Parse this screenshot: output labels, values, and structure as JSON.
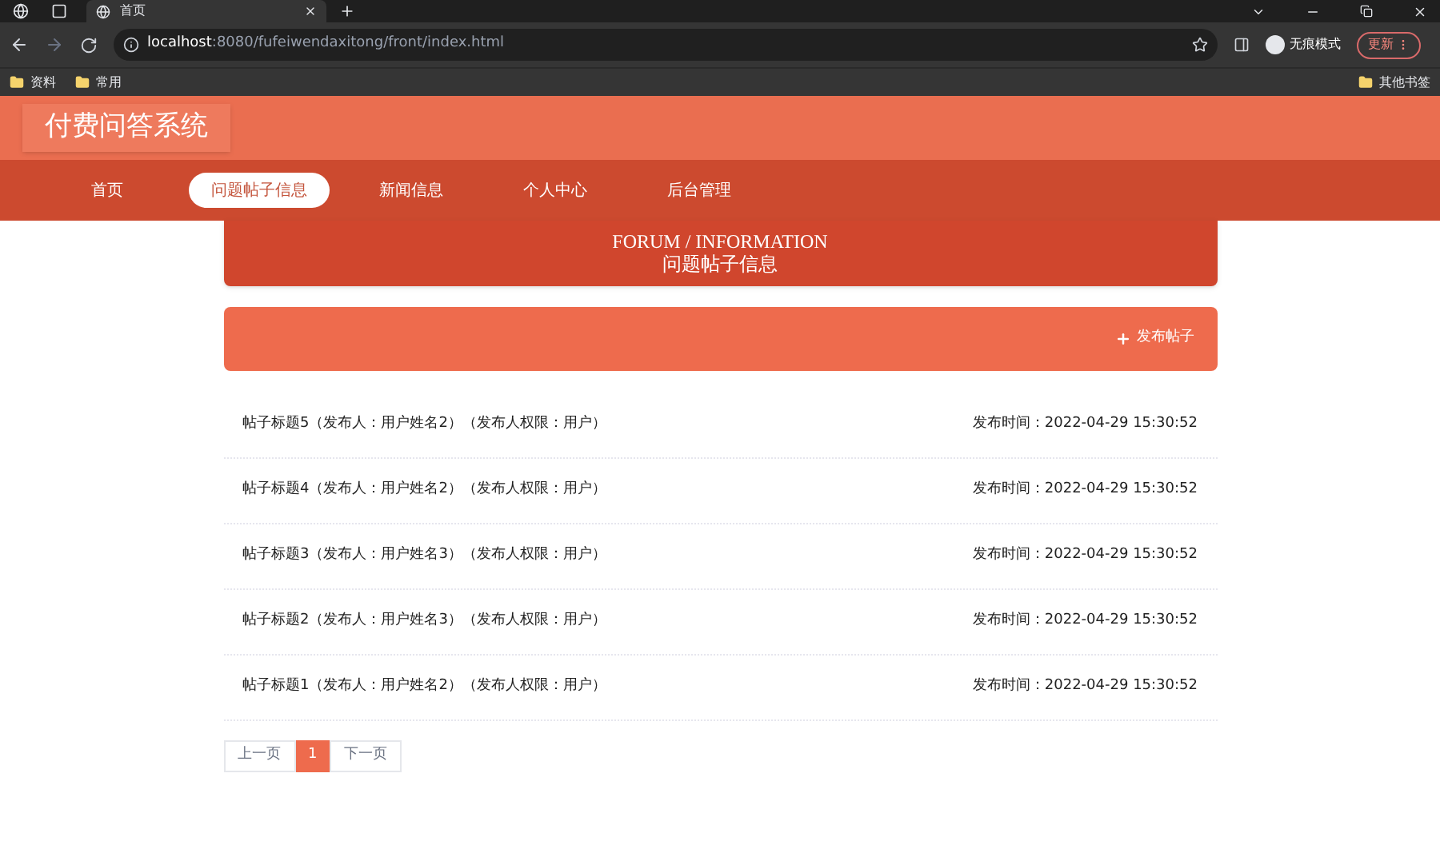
{
  "browser": {
    "tab_title": "首页",
    "url_host": "localhost",
    "url_path": ":8080/fufeiwendaxitong/front/index.html",
    "profile": "无痕模式",
    "update_button": "更新",
    "bookmarks": [
      "资料",
      "常用"
    ],
    "other_bookmarks": "其他书签"
  },
  "site": {
    "title": "付费问答系统"
  },
  "nav": [
    {
      "label": "首页",
      "selected": false
    },
    {
      "label": "问题帖子信息",
      "selected": true
    },
    {
      "label": "新闻信息",
      "selected": false
    },
    {
      "label": "个人中心",
      "selected": false
    },
    {
      "label": "后台管理",
      "selected": false
    }
  ],
  "banner": {
    "english": "FORUM / INFORMATION",
    "title": "问题帖子信息"
  },
  "publish_button": "发布帖子",
  "posts": [
    {
      "title": "帖子标题5（发布人：用户姓名2）（发布人权限：用户）",
      "time": "发布时间：2022-04-29 15:30:52"
    },
    {
      "title": "帖子标题4（发布人：用户姓名2）（发布人权限：用户）",
      "time": "发布时间：2022-04-29 15:30:52"
    },
    {
      "title": "帖子标题3（发布人：用户姓名3）（发布人权限：用户）",
      "time": "发布时间：2022-04-29 15:30:52"
    },
    {
      "title": "帖子标题2（发布人：用户姓名3）（发布人权限：用户）",
      "time": "发布时间：2022-04-29 15:30:52"
    },
    {
      "title": "帖子标题1（发布人：用户姓名2）（发布人权限：用户）",
      "time": "发布时间：2022-04-29 15:30:52"
    }
  ],
  "pagination": [
    {
      "label": "上一页",
      "selected": false
    },
    {
      "label": "1",
      "selected": true
    },
    {
      "label": "下一页",
      "selected": false
    }
  ]
}
